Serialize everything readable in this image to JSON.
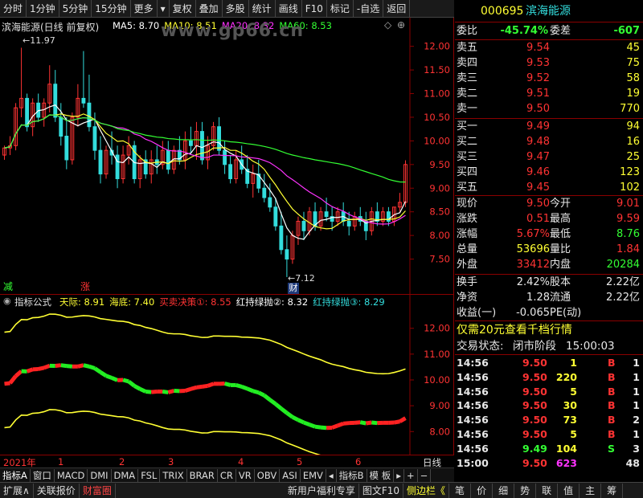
{
  "toolbar": {
    "items": [
      "分时",
      "1分钟",
      "5分钟",
      "15分钟",
      "更多",
      "复权",
      "叠加",
      "多股",
      "统计",
      "画线",
      "F10",
      "标记",
      "-自选",
      "返回"
    ],
    "dropdown_glyph": "▾"
  },
  "main_chart": {
    "stock_label": "滨海能源(日线 前复权)",
    "ma_legend": [
      {
        "label": "MA5: 8.70",
        "color": "#ffffff"
      },
      {
        "label": "MA10: 8.51",
        "color": "#ffff33"
      },
      {
        "label": "MA20: 8.32",
        "color": "#ff33ff"
      },
      {
        "label": "MA60: 8.53",
        "color": "#33ff33"
      }
    ],
    "high_marker": "11.97",
    "low_marker": "7.12",
    "price_ticks": [
      "12.00",
      "11.50",
      "11.00",
      "10.50",
      "10.00",
      "9.50",
      "9.00",
      "8.50",
      "8.00",
      "7.50"
    ],
    "badge_reduce": "减",
    "badge_rise": "涨",
    "badge_finance": "财",
    "watermark": "www.gp66.cn"
  },
  "indicator_chart": {
    "name": "指标公式",
    "legend": [
      {
        "label": "天际: 8.91",
        "color": "#ffff33"
      },
      {
        "label": "海底: 7.40",
        "color": "#ffff33"
      },
      {
        "label": "买卖决策①: 8.55",
        "color": "#ff3333"
      },
      {
        "label": "红持绿抛②: 8.32",
        "color": "#ffffff"
      },
      {
        "label": "红持绿抛③: 8.29",
        "color": "#33dddd"
      }
    ],
    "ticks": [
      "12.00",
      "11.00",
      "10.00",
      "9.00",
      "8.00"
    ]
  },
  "x_axis": {
    "labels": [
      "2021年",
      "1",
      "2",
      "3",
      "4",
      "5",
      "6"
    ],
    "period": "日线"
  },
  "tabs": [
    "指标A",
    "窗口",
    "MACD",
    "DMI",
    "DMA",
    "FSL",
    "TRIX",
    "BRAR",
    "CR",
    "VR",
    "OBV",
    "ASI",
    "EMV",
    "◂",
    "指标B",
    "模 板",
    "▸",
    "+",
    "−"
  ],
  "bottom_bar": [
    "扩展∧",
    "关联报价",
    "财富圈",
    "新用户福利专享",
    "图文F10",
    "侧边栏《",
    "笔",
    "价",
    "细",
    "势",
    "联",
    "值",
    "主",
    "筹"
  ],
  "quote": {
    "code": "000695",
    "name": "滨海能源",
    "webi_label": "委比",
    "webi_value": "-45.74%",
    "weicha_label": "委差",
    "weicha_value": "-607",
    "sell": [
      {
        "label": "卖五",
        "price": "9.54",
        "vol": "45"
      },
      {
        "label": "卖四",
        "price": "9.53",
        "vol": "75"
      },
      {
        "label": "卖三",
        "price": "9.52",
        "vol": "58"
      },
      {
        "label": "卖二",
        "price": "9.51",
        "vol": "19"
      },
      {
        "label": "卖一",
        "price": "9.50",
        "vol": "770"
      }
    ],
    "buy": [
      {
        "label": "买一",
        "price": "9.49",
        "vol": "94"
      },
      {
        "label": "买二",
        "price": "9.48",
        "vol": "16"
      },
      {
        "label": "买三",
        "price": "9.47",
        "vol": "25"
      },
      {
        "label": "买四",
        "price": "9.46",
        "vol": "123"
      },
      {
        "label": "买五",
        "price": "9.45",
        "vol": "102"
      }
    ],
    "stats": [
      {
        "l1": "现价",
        "v1": "9.50",
        "c1": "red",
        "l2": "今开",
        "v2": "9.01",
        "c2": "red"
      },
      {
        "l1": "涨跌",
        "v1": "0.51",
        "c1": "red",
        "l2": "最高",
        "v2": "9.59",
        "c2": "red"
      },
      {
        "l1": "涨幅",
        "v1": "5.67%",
        "c1": "red",
        "l2": "最低",
        "v2": "8.76",
        "c2": "green"
      },
      {
        "l1": "总量",
        "v1": "53696",
        "c1": "yellow",
        "l2": "量比",
        "v2": "1.84",
        "c2": "red"
      },
      {
        "l1": "外盘",
        "v1": "33412",
        "c1": "red",
        "l2": "内盘",
        "v2": "20284",
        "c2": "green"
      }
    ],
    "stats2": [
      {
        "l1": "换手",
        "v1": "2.42%",
        "l2": "股本",
        "v2": "2.22亿"
      },
      {
        "l1": "净资",
        "v1": "1.28",
        "l2": "流通",
        "v2": "2.22亿"
      },
      {
        "l1": "收益(一)",
        "v1": "-0.065",
        "l2": "PE(动)",
        "v2": ""
      }
    ],
    "promo": "仅需20元查看千档行情",
    "status_label": "交易状态:",
    "status_value": "闭市阶段",
    "status_time": "15:00:03",
    "ticks": [
      {
        "time": "14:56",
        "price": "9.50",
        "vol": "1",
        "side": "B",
        "n": "1",
        "sc": "red",
        "vc": "yellow"
      },
      {
        "time": "14:56",
        "price": "9.50",
        "vol": "220",
        "side": "B",
        "n": "1",
        "sc": "red",
        "vc": "yellow"
      },
      {
        "time": "14:56",
        "price": "9.50",
        "vol": "5",
        "side": "B",
        "n": "1",
        "sc": "red",
        "vc": "yellow"
      },
      {
        "time": "14:56",
        "price": "9.50",
        "vol": "30",
        "side": "B",
        "n": "1",
        "sc": "red",
        "vc": "yellow"
      },
      {
        "time": "14:56",
        "price": "9.50",
        "vol": "73",
        "side": "B",
        "n": "2",
        "sc": "red",
        "vc": "yellow"
      },
      {
        "time": "14:56",
        "price": "9.50",
        "vol": "5",
        "side": "B",
        "n": "1",
        "sc": "red",
        "vc": "yellow"
      },
      {
        "time": "14:56",
        "price": "9.49",
        "vol": "104",
        "side": "S",
        "n": "3",
        "sc": "green",
        "vc": "yellow"
      },
      {
        "time": "15:00",
        "price": "9.50",
        "vol": "623",
        "side": "",
        "n": "48",
        "sc": "red",
        "vc": "mag"
      }
    ]
  },
  "chart_data": {
    "type": "line",
    "price_axis": {
      "min": 7.0,
      "max": 12.3
    },
    "candles": [
      [
        9.7,
        9.9,
        9.6,
        9.85
      ],
      [
        9.85,
        10.1,
        9.7,
        9.9
      ],
      [
        9.9,
        10.8,
        9.8,
        10.7
      ],
      [
        10.7,
        11.97,
        10.5,
        10.9
      ],
      [
        10.9,
        11.0,
        10.2,
        10.3
      ],
      [
        10.3,
        10.9,
        10.1,
        10.8
      ],
      [
        10.8,
        11.0,
        10.4,
        10.5
      ],
      [
        10.5,
        10.9,
        10.3,
        10.8
      ],
      [
        10.8,
        11.6,
        10.6,
        11.2
      ],
      [
        11.2,
        11.5,
        10.4,
        10.5
      ],
      [
        10.5,
        10.8,
        9.9,
        10.1
      ],
      [
        10.1,
        10.5,
        9.4,
        9.6
      ],
      [
        9.6,
        10.6,
        9.5,
        10.5
      ],
      [
        10.5,
        11.2,
        10.3,
        10.9
      ],
      [
        10.9,
        11.9,
        10.7,
        10.8
      ],
      [
        10.8,
        11.4,
        10.2,
        10.3
      ],
      [
        10.3,
        10.6,
        9.6,
        9.8
      ],
      [
        9.8,
        10.1,
        9.1,
        9.3
      ],
      [
        9.3,
        9.9,
        9.2,
        9.8
      ],
      [
        9.8,
        10.2,
        9.5,
        9.7
      ],
      [
        9.7,
        9.9,
        9.0,
        9.2
      ],
      [
        9.2,
        9.9,
        9.1,
        9.7
      ],
      [
        9.7,
        10.1,
        9.5,
        9.9
      ],
      [
        9.9,
        10.0,
        9.1,
        9.2
      ],
      [
        9.2,
        9.7,
        9.0,
        9.6
      ],
      [
        9.6,
        9.8,
        9.2,
        9.3
      ],
      [
        9.3,
        9.8,
        9.1,
        9.6
      ],
      [
        9.6,
        9.9,
        9.3,
        9.5
      ],
      [
        9.5,
        10.0,
        9.4,
        9.8
      ],
      [
        9.8,
        10.0,
        9.3,
        9.4
      ],
      [
        9.4,
        9.9,
        9.3,
        9.8
      ],
      [
        9.8,
        10.1,
        9.5,
        9.6
      ],
      [
        9.6,
        10.2,
        9.4,
        10.0
      ],
      [
        10.0,
        10.3,
        9.7,
        9.9
      ],
      [
        9.9,
        10.4,
        9.6,
        10.2
      ],
      [
        10.2,
        10.4,
        9.5,
        9.6
      ],
      [
        9.6,
        10.1,
        9.4,
        9.9
      ],
      [
        9.9,
        10.4,
        9.8,
        10.3
      ],
      [
        10.3,
        10.5,
        9.7,
        9.8
      ],
      [
        9.8,
        10.0,
        9.3,
        9.5
      ],
      [
        9.5,
        9.7,
        9.1,
        9.2
      ],
      [
        9.2,
        9.8,
        9.1,
        9.6
      ],
      [
        9.6,
        9.9,
        9.3,
        9.4
      ],
      [
        9.4,
        9.7,
        9.0,
        9.1
      ],
      [
        9.1,
        9.5,
        8.8,
        9.3
      ],
      [
        9.3,
        9.6,
        8.9,
        9.0
      ],
      [
        9.0,
        9.3,
        8.7,
        8.8
      ],
      [
        8.8,
        9.1,
        8.5,
        8.6
      ],
      [
        8.6,
        8.8,
        8.1,
        8.2
      ],
      [
        8.2,
        8.5,
        7.6,
        7.7
      ],
      [
        7.7,
        8.0,
        7.12,
        7.5
      ],
      [
        7.5,
        8.1,
        7.4,
        8.0
      ],
      [
        8.0,
        8.4,
        7.8,
        8.3
      ],
      [
        8.3,
        8.5,
        7.9,
        8.1
      ],
      [
        8.1,
        8.6,
        8.0,
        8.5
      ],
      [
        8.5,
        8.7,
        8.1,
        8.2
      ],
      [
        8.2,
        8.6,
        8.1,
        8.5
      ],
      [
        8.5,
        8.8,
        8.3,
        8.4
      ],
      [
        8.4,
        8.6,
        8.1,
        8.3
      ],
      [
        8.3,
        8.6,
        8.2,
        8.5
      ],
      [
        8.5,
        8.7,
        8.2,
        8.3
      ],
      [
        8.3,
        8.5,
        8.0,
        8.2
      ],
      [
        8.2,
        8.5,
        8.1,
        8.4
      ],
      [
        8.4,
        8.6,
        8.2,
        8.3
      ],
      [
        8.3,
        8.5,
        7.9,
        8.1
      ],
      [
        8.1,
        8.6,
        8.0,
        8.5
      ],
      [
        8.5,
        8.7,
        8.2,
        8.3
      ],
      [
        8.3,
        8.6,
        8.2,
        8.5
      ],
      [
        8.5,
        8.6,
        8.2,
        8.3
      ],
      [
        8.3,
        8.6,
        8.2,
        8.6
      ],
      [
        8.6,
        8.9,
        8.5,
        8.7
      ],
      [
        8.7,
        9.59,
        8.6,
        9.5
      ]
    ],
    "ma5_end": 8.7,
    "ma10_end": 8.51,
    "ma20_end": 8.32,
    "ma60_end": 8.53,
    "indicator": {
      "tianji_end": 8.91,
      "haidi_end": 7.4,
      "decision_end": 8.55,
      "hold2_end": 8.32,
      "hold3_end": 8.29,
      "ylim": [
        7.2,
        12.8
      ]
    }
  }
}
